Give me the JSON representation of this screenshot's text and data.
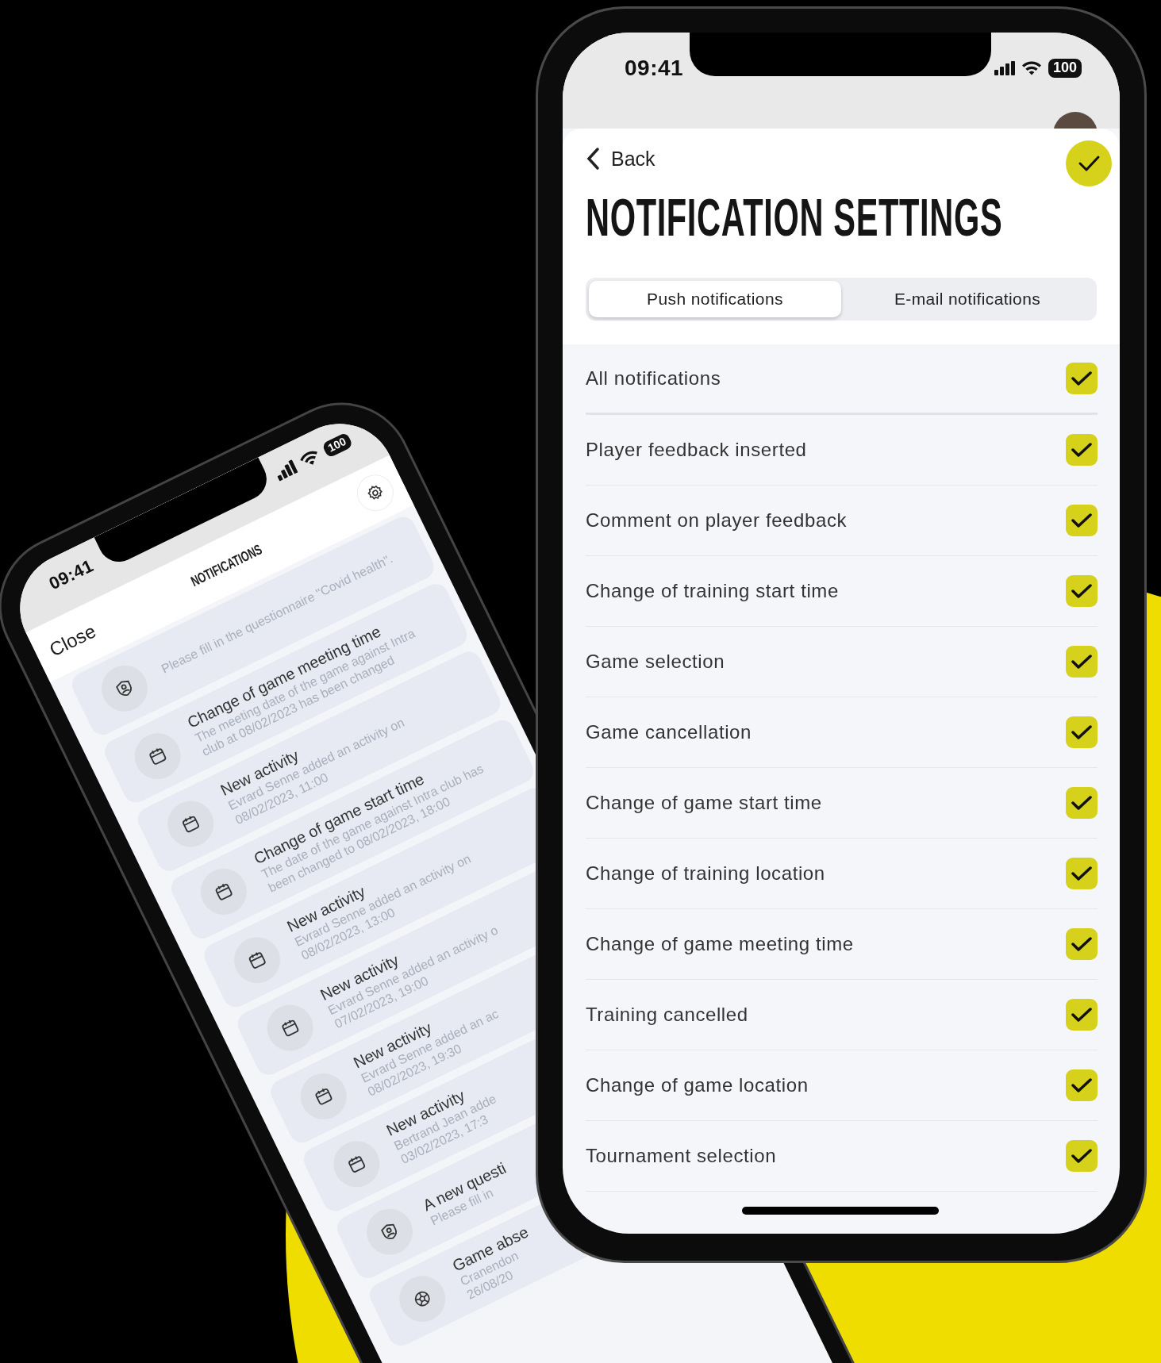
{
  "tilted_phone": {
    "status_bar": {
      "time": "09:41",
      "battery": "100"
    },
    "close": "Close",
    "title": "NOTIFICATIONS",
    "notifications": [
      {
        "kind": "questionnaire",
        "lines": [
          "Please fill in the questionnaire \"Covid health\"."
        ]
      },
      {
        "kind": "calendar",
        "title": "Change of game meeting time",
        "lines": [
          "The meeting date of the game against Intra",
          "club at 08/02/2023 has been changed"
        ]
      },
      {
        "kind": "calendar",
        "title": "New activity",
        "lines": [
          "Evrard Senne added an activity on",
          "08/02/2023, 11:00"
        ]
      },
      {
        "kind": "calendar",
        "title": "Change of game start time",
        "lines": [
          "The date of the game against Intra club has",
          "been changed to 08/02/2023, 18:00"
        ]
      },
      {
        "kind": "calendar",
        "title": "New activity",
        "lines": [
          "Evrard Senne added an activity on",
          "08/02/2023, 13:00"
        ]
      },
      {
        "kind": "calendar",
        "title": "New activity",
        "lines": [
          "Evrard Senne added an activity o",
          "07/02/2023, 19:00"
        ]
      },
      {
        "kind": "calendar",
        "title": "New activity",
        "lines": [
          "Evrard Senne added an ac",
          "08/02/2023, 19:30"
        ]
      },
      {
        "kind": "calendar",
        "title": "New activity",
        "lines": [
          "Bertrand Jean adde",
          "03/02/2023, 17:3"
        ]
      },
      {
        "kind": "questionnaire",
        "title": "A new questi",
        "lines": [
          "Please fill in"
        ]
      },
      {
        "kind": "game",
        "title": "Game abse",
        "lines": [
          "Cranendon",
          "26/08/20"
        ]
      }
    ]
  },
  "main_phone": {
    "status_bar": {
      "time": "09:41",
      "battery": "100"
    },
    "back": "Back",
    "title": "NOTIFICATION SETTINGS",
    "tabs": [
      {
        "label": "Push notifications",
        "selected": true
      },
      {
        "label": "E-mail notifications",
        "selected": false
      }
    ],
    "settings": [
      {
        "kind": "master",
        "label": "All notifications",
        "checked": true
      },
      {
        "kind": "item",
        "label": "Player feedback inserted",
        "checked": true
      },
      {
        "kind": "item",
        "label": "Comment on player feedback",
        "checked": true
      },
      {
        "kind": "item",
        "label": "Change of training start time",
        "checked": true
      },
      {
        "kind": "item",
        "label": "Game selection",
        "checked": true
      },
      {
        "kind": "item",
        "label": "Game cancellation",
        "checked": true
      },
      {
        "kind": "item",
        "label": "Change of game start time",
        "checked": true
      },
      {
        "kind": "item",
        "label": "Change of training location",
        "checked": true
      },
      {
        "kind": "item",
        "label": "Change of game meeting time",
        "checked": true
      },
      {
        "kind": "item",
        "label": "Training cancelled",
        "checked": true
      },
      {
        "kind": "item",
        "label": "Change of game location",
        "checked": true
      },
      {
        "kind": "item",
        "label": "Tournament selection",
        "checked": true
      }
    ]
  }
}
